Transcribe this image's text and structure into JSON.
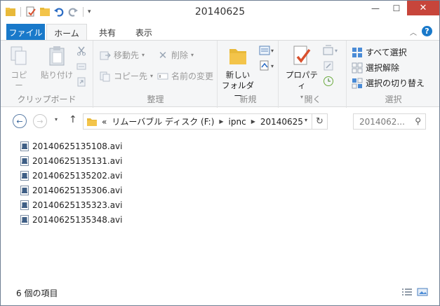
{
  "window": {
    "title": "20140625"
  },
  "ribbon_tabs": {
    "file": "ファイル",
    "home": "ホーム",
    "share": "共有",
    "view": "表示"
  },
  "clipboard": {
    "copy": "コピー",
    "paste": "貼り付け",
    "label": "クリップボード"
  },
  "organize": {
    "move_to": "移動先",
    "copy_to": "コピー先",
    "delete": "削除",
    "rename": "名前の変更",
    "label": "整理"
  },
  "new": {
    "new_folder_line1": "新しい",
    "new_folder_line2": "フォルダー",
    "label": "新規"
  },
  "open": {
    "properties": "プロパティ",
    "label": "開く"
  },
  "select": {
    "select_all": "すべて選択",
    "select_none": "選択解除",
    "invert": "選択の切り替え",
    "label": "選択"
  },
  "address": {
    "overflow": "«",
    "crumbs": [
      "リムーバブル ディスク (F:)",
      "ipnc",
      "20140625"
    ]
  },
  "search": {
    "placeholder": "2014062..."
  },
  "files": [
    "20140625135108.avi",
    "20140625135131.avi",
    "20140625135202.avi",
    "20140625135306.avi",
    "20140625135323.avi",
    "20140625135348.avi"
  ],
  "status": {
    "item_count": "6 個の項目"
  },
  "colors": {
    "accent": "#1979ca",
    "close": "#c7453b",
    "folder": "#f3c44a"
  }
}
